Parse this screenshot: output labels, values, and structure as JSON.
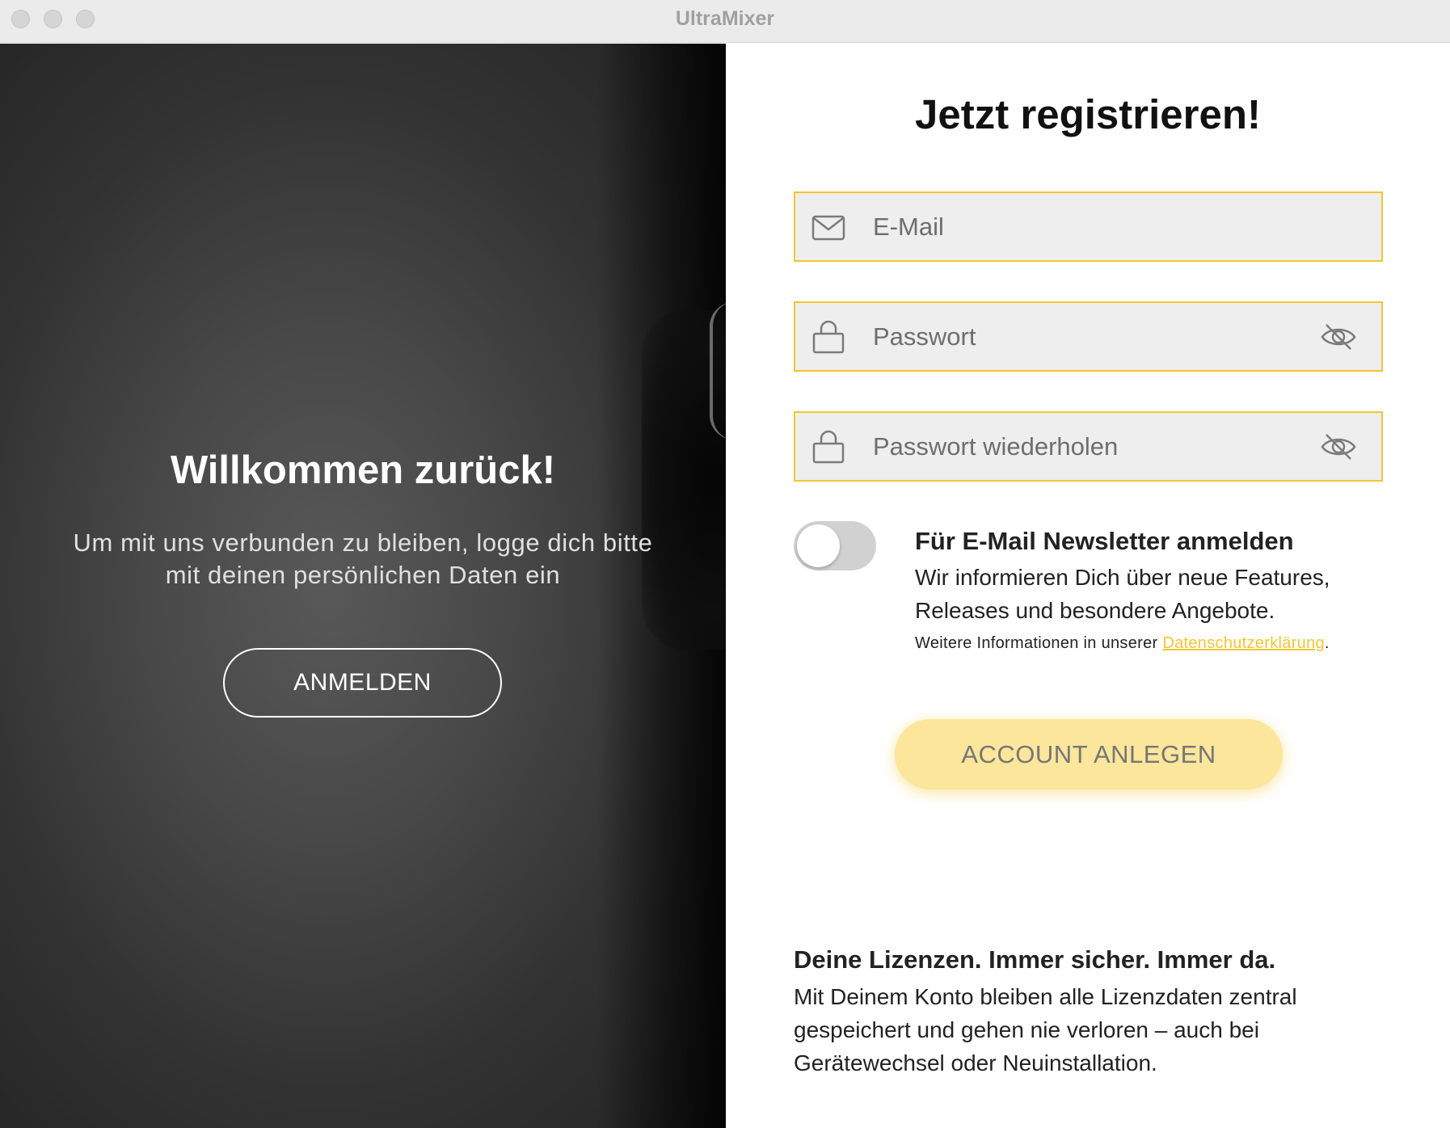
{
  "window": {
    "title": "UltraMixer"
  },
  "left_panel": {
    "title": "Willkommen zurück!",
    "text": "Um mit uns verbunden zu bleiben, logge dich bitte mit deinen persönlichen Daten ein",
    "login_button_label": "ANMELDEN"
  },
  "right_panel": {
    "title": "Jetzt registrieren!",
    "email": {
      "placeholder": "E-Mail",
      "value": "",
      "icon": "envelope-icon"
    },
    "password": {
      "placeholder": "Passwort",
      "value": "",
      "icon": "lock-icon",
      "visibility_icon": "eye-slash-icon"
    },
    "password_repeat": {
      "placeholder": "Passwort wiederholen",
      "value": "",
      "icon": "lock-icon",
      "visibility_icon": "eye-slash-icon"
    },
    "newsletter": {
      "enabled": false,
      "title": "Für E-Mail Newsletter anmelden",
      "text": "Wir informieren Dich über neue Features, Releases und besondere Angebote.",
      "privacy_prefix": "Weitere Informationen in unserer ",
      "privacy_link": "Datenschutzerklärung",
      "privacy_suffix": "."
    },
    "create_button_label": "ACCOUNT ANLEGEN",
    "license": {
      "title": "Deine Lizenzen. Immer sicher. Immer da.",
      "text": "Mit Deinem Konto bleiben alle Lizenzdaten zentral gespeichert und gehen nie verloren – auch bei Gerätewechsel oder Neuinstallation."
    }
  },
  "colors": {
    "accent": "#f4c531",
    "button_fill": "#fbe69b",
    "field_bg": "#eeeeee"
  }
}
